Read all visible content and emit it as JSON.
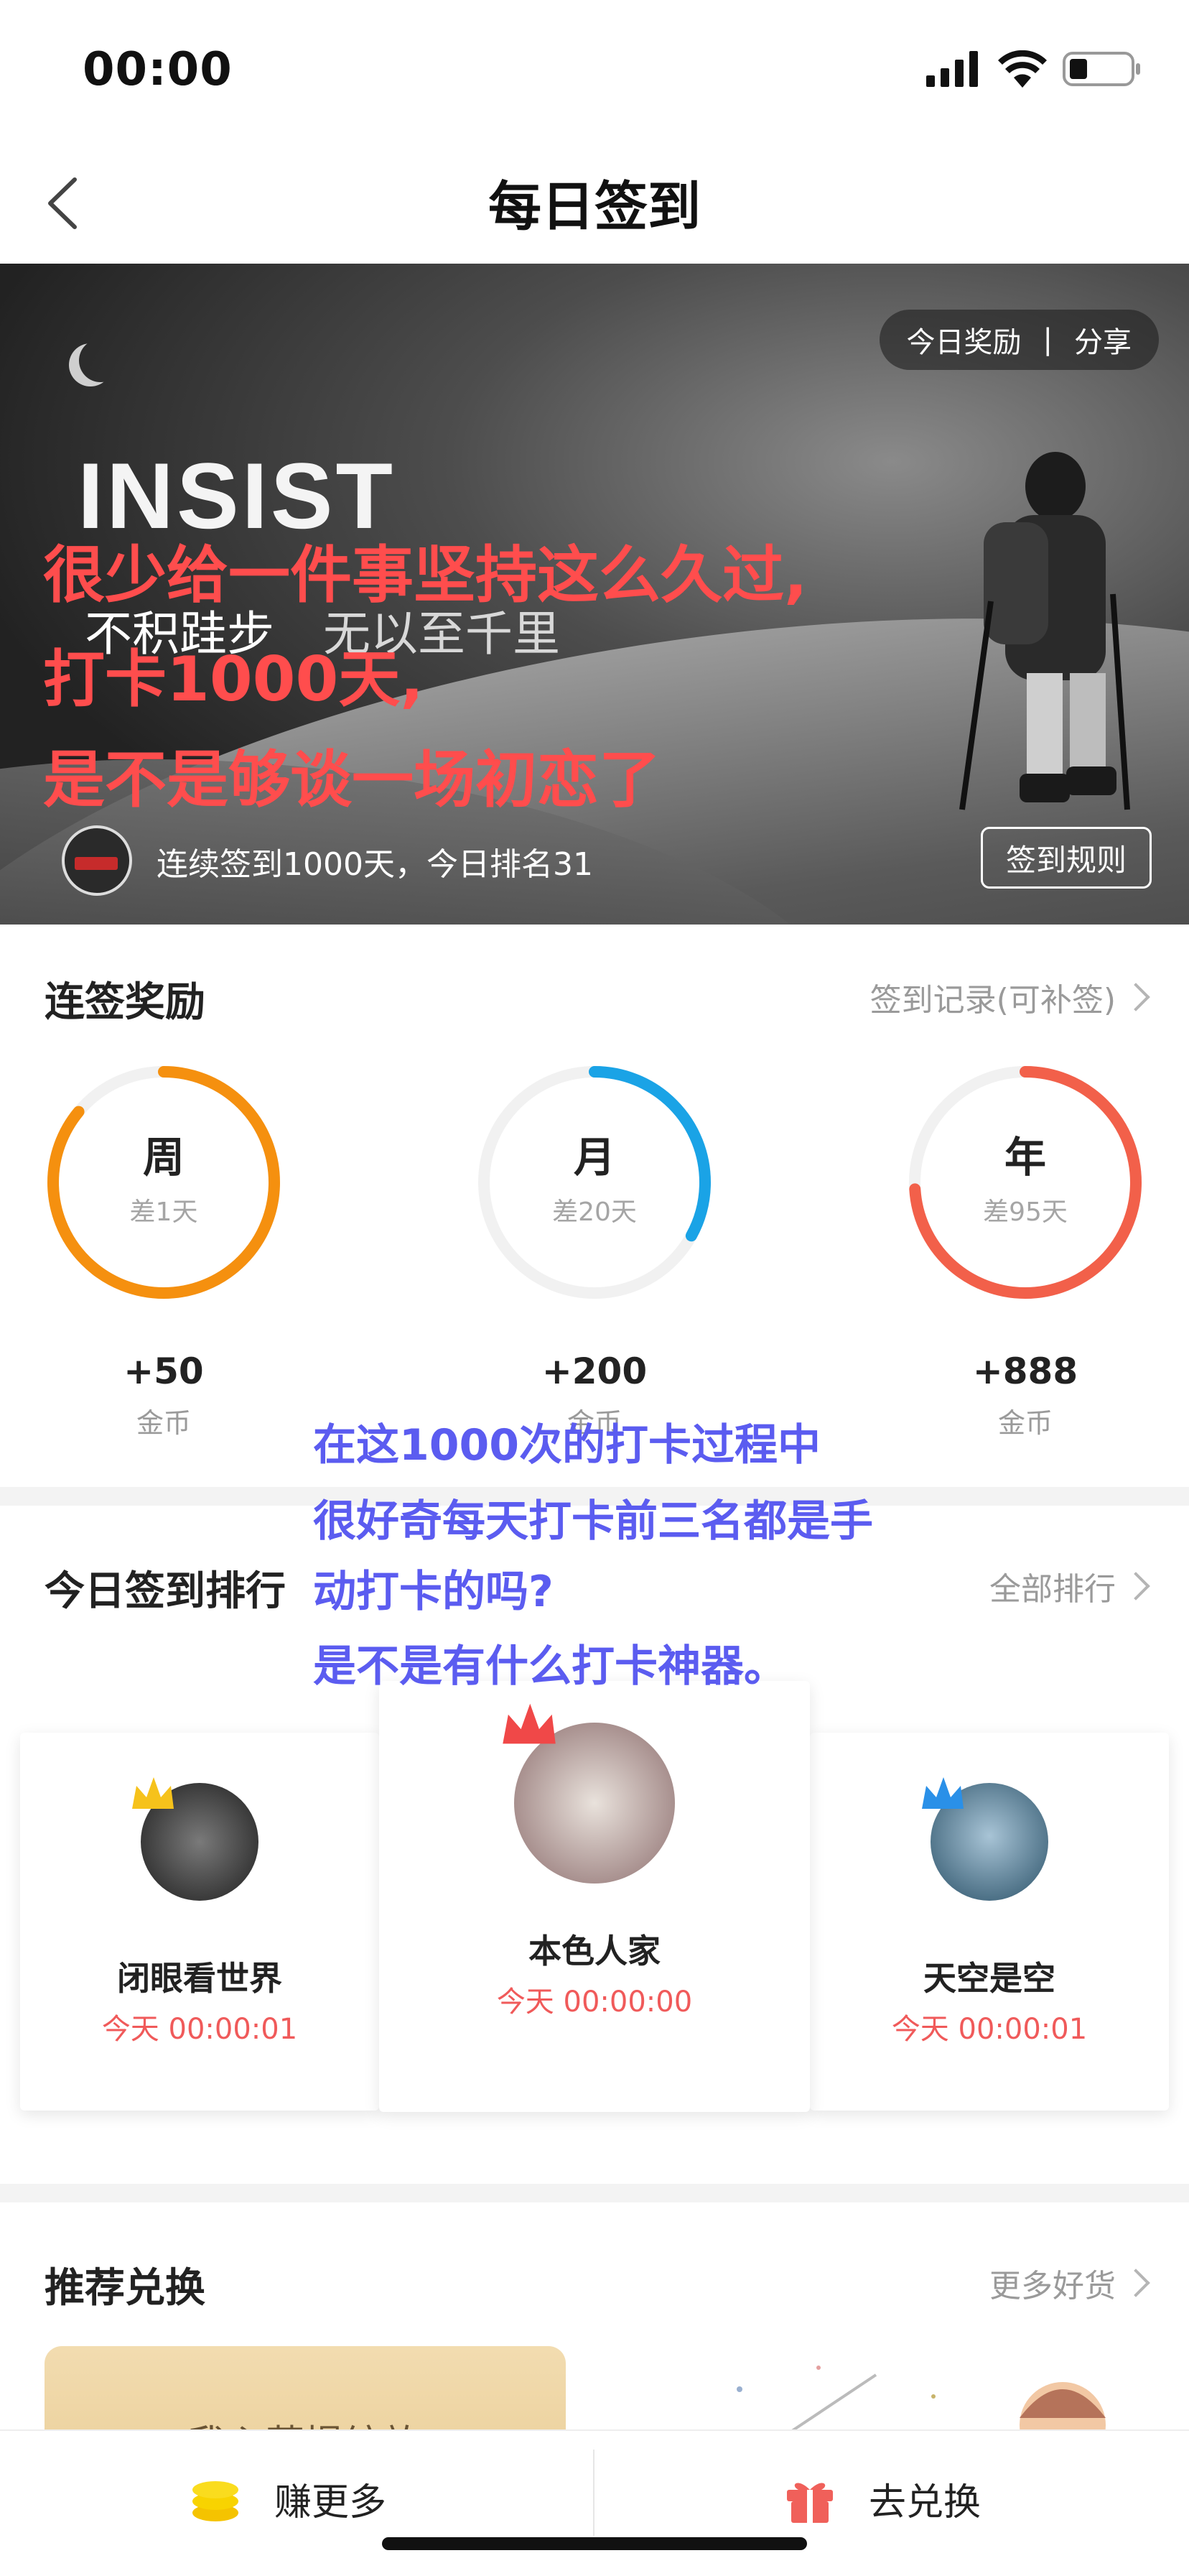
{
  "status_bar": {
    "time": "00:00"
  },
  "nav": {
    "title": "每日签到"
  },
  "banner": {
    "reward_link": "今日奖励",
    "separator": "|",
    "share_link": "分享",
    "insist": "INSIST",
    "slogan_part1": "不积跬步",
    "slogan_part2": "无以至千里",
    "rank_text": "连续签到1000天，今日排名31",
    "rules_button": "签到规则"
  },
  "overlay_red": {
    "line1": "很少给一件事坚持这么久过,",
    "line2": "打卡1000天,",
    "line3": "是不是够谈一场初恋了"
  },
  "streak": {
    "title": "连签奖励",
    "link": "签到记录(可补签)",
    "rings": [
      {
        "name": "周",
        "sub": "差1天",
        "value": "+50",
        "unit": "金币",
        "progress": 0.86,
        "color": "#f5900f"
      },
      {
        "name": "月",
        "sub": "差20天",
        "value": "+200",
        "unit": "金币",
        "progress": 0.33,
        "color": "#1aa3e6"
      },
      {
        "name": "年",
        "sub": "差95天",
        "value": "+888",
        "unit": "金币",
        "progress": 0.74,
        "color": "#f2604a"
      }
    ]
  },
  "overlay_blue": {
    "line1": "在这1000次的打卡过程中",
    "line2": "很好奇每天打卡前三名都是手",
    "line3": "动打卡的吗?",
    "line4": "是不是有什么打卡神器。"
  },
  "ranking": {
    "title": "今日签到排行",
    "link": "全部排行",
    "cards": [
      {
        "name": "闭眼看世界",
        "time": "今天 00:00:01",
        "crown_color": "#f6c21b"
      },
      {
        "name": "本色人家",
        "time": "今天 00:00:00",
        "crown_color": "#f04848"
      },
      {
        "name": "天空是空",
        "time": "今天 00:00:01",
        "crown_color": "#2a90e8"
      }
    ]
  },
  "recommend": {
    "title": "推荐兑换",
    "link": "更多好货",
    "promo_text": "我心菩提绽放"
  },
  "tabbar": {
    "earn": "赚更多",
    "redeem": "去兑换"
  },
  "colors": {
    "accent_red": "#f05a5a",
    "overlay_red": "#ff4d4d",
    "overlay_blue": "#5b5cf0"
  }
}
